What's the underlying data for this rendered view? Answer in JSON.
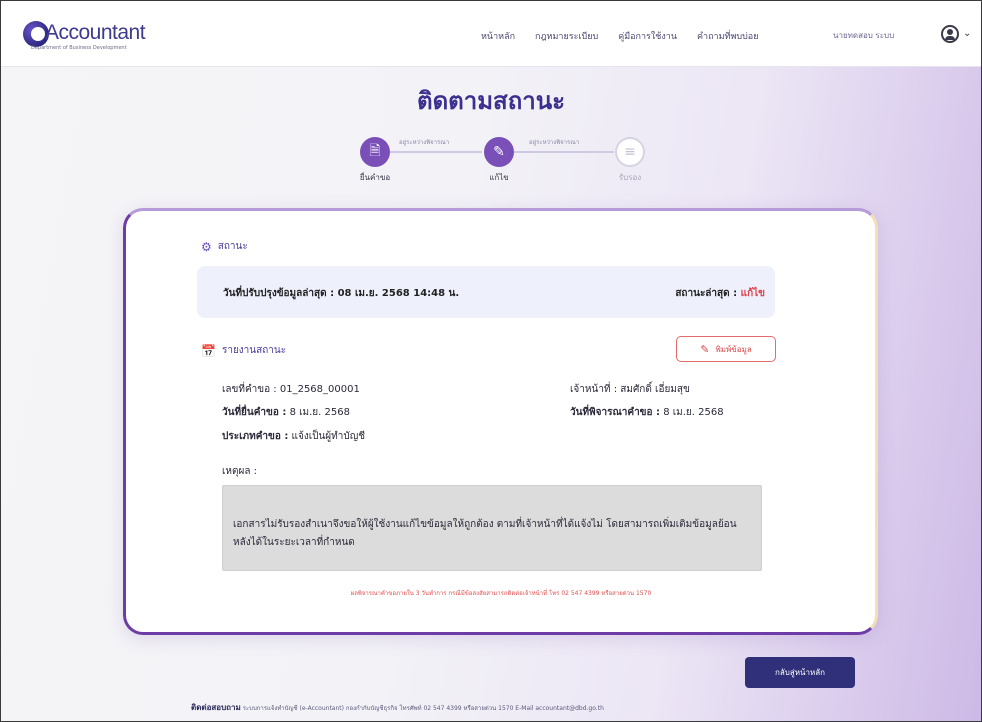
{
  "header": {
    "logo_text": "Accountant",
    "logo_sub": "Department of Business Development",
    "nav": [
      "หน้าหลัก",
      "กฎหมายระเบียบ",
      "คู่มือการใช้งาน",
      "คำถามที่พบบ่อย"
    ],
    "user_name": "นายทดสอบ ระบบ",
    "user_icon": "user-circle-icon",
    "chevron_icon": "chevron-down-icon"
  },
  "page_title": "ติดตามสถานะ",
  "stepper": {
    "steps": [
      {
        "label": "ยื่นคำขอ",
        "state": "done",
        "icon": "document-icon"
      },
      {
        "label": "แก้ไข",
        "state": "active",
        "icon": "edit-icon"
      },
      {
        "label": "รับรอง",
        "state": "pending",
        "icon": "checklist-icon"
      }
    ],
    "connectors": [
      "อยู่ระหว่างพิจารณา",
      "อยู่ระหว่างพิจารณา"
    ]
  },
  "status_section": {
    "heading": "สถานะ",
    "updated_label": "วันที่ปรับปรุงข้อมูลล่าสุด :",
    "updated_value": "08 เม.ย. 2568 14:48 น.",
    "status_label": "สถานะล่าสุด :",
    "status_value": "แก้ไข"
  },
  "report_section": {
    "heading": "รายงานสถานะ",
    "print_button": "พิมพ์ข้อมูล",
    "request_no_label": "เลขที่คำขอ :",
    "request_no": "01_2568_00001",
    "submit_date_label": "วันที่ยื่นคำขอ :",
    "submit_date": "8 เม.ย. 2568",
    "type_label": "ประเภทคำขอ :",
    "type_value": "แจ้งเป็นผู้ทำบัญชี",
    "officer_label": "เจ้าหน้าที่ :",
    "officer_value": "สมศักดิ์ เอี่ยมสุข",
    "review_date_label": "วันที่พิจารณาคำขอ :",
    "review_date": "8 เม.ย. 2568",
    "reason_label": "เหตุผล :",
    "reason_text": "เอกสารไม่รับรองสำเนาจึงขอให้ผู้ใช้งานแก้ไขข้อมูลให้ถูกต้อง ตามที่เจ้าหน้าที่ได้แจ้งไม่ โดยสามารถเพิ่มเติมข้อมูลย้อนหลังได้ในระยะเวลาที่กำหนด",
    "note": "ผลพิจารณาคำขอภายใน 3 วันทำการ กรณีมีข้อสงสัยสามารถติดต่อเจ้าหน้าที่ โทร 02 547 4399 หรือสายด่วน 1570"
  },
  "back_button": "กลับสู่หน้าหลัก",
  "footer": {
    "title": "ติดต่อสอบถาม",
    "text": "ระบบการแจ้งทำบัญชี (e-Accountant) กองกำกับบัญชีธุรกิจ โทรศัพท์ 02 547 4399 หรือสายด่วน 1570 E-Mail accountant@dbd.go.th"
  }
}
